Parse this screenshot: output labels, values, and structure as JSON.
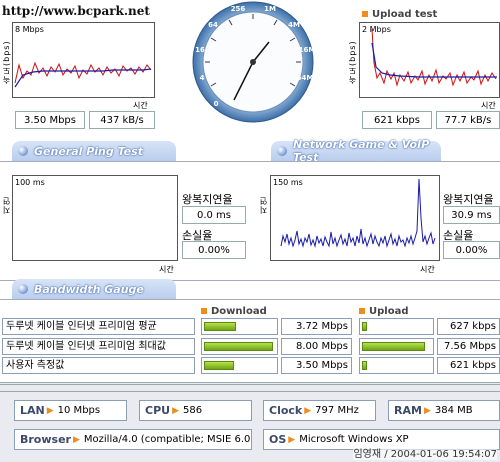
{
  "watermark": "http://www.bcpark.net",
  "download": {
    "axis_label": "속도(bps)",
    "scale": "8 Mbps",
    "time_label": "시간",
    "speed_bps": "3.50 Mbps",
    "speed_bytes": "437 kB/s"
  },
  "upload": {
    "title": "Upload test",
    "axis_label": "속도(bps)",
    "scale": "2 Mbps",
    "time_label": "시간",
    "speed_bps": "621 kbps",
    "speed_bytes": "77.7 kB/s"
  },
  "gauge": {
    "ticks": [
      "0",
      "4",
      "16",
      "64",
      "256",
      "1M",
      "4M",
      "16M",
      "64M"
    ]
  },
  "tabs": {
    "ping": "General Ping Test",
    "game": "Network Game & VoIP Test",
    "bandwidth": "Bandwidth Gauge"
  },
  "ping_general": {
    "axis_label": "지연(ms)",
    "scale": "100 ms",
    "time_label": "시간",
    "rtt_label": "왕복지연율",
    "rtt_value": "0.0 ms",
    "loss_label": "손실율",
    "loss_value": "0.00%"
  },
  "ping_game": {
    "axis_label": "지연(ms)",
    "scale": "150 ms",
    "time_label": "시간",
    "rtt_label": "왕복지연율",
    "rtt_value": "30.9 ms",
    "loss_label": "손실율",
    "loss_value": "0.00%"
  },
  "bandwidth": {
    "download_header": "Download",
    "upload_header": "Upload",
    "rows": [
      {
        "label": "두루넷 케이블 인터넷 프리미엄 평균",
        "down": "3.72 Mbps",
        "down_frac": 0.46,
        "up": "627 kbps",
        "up_frac": 0.08
      },
      {
        "label": "두루넷 케이블 인터넷 프리미엄 최대값",
        "down": "8.00 Mbps",
        "down_frac": 1.0,
        "up": "7.56 Mbps",
        "up_frac": 0.94
      },
      {
        "label": "사용자 측정값",
        "down": "3.50 Mbps",
        "down_frac": 0.44,
        "up": "621 kbps",
        "up_frac": 0.08
      }
    ]
  },
  "sysinfo": {
    "lan_key": "LAN",
    "lan_val": "10 Mbps",
    "cpu_key": "CPU",
    "cpu_val": "586",
    "clock_key": "Clock",
    "clock_val": "797 MHz",
    "ram_key": "RAM",
    "ram_val": "384 MB",
    "browser_key": "Browser",
    "browser_val": "Mozilla/4.0 (compatible; MSIE 6.0",
    "os_key": "OS",
    "os_val": "Microsoft Windows XP"
  },
  "footer_stamp": "임영재 / 2004-01-06 19:54:07",
  "colors": {
    "accent_orange": "#f08c1e",
    "chart_red": "#cc1111",
    "chart_blue": "#1a1aaa",
    "frame_blue": "#8c9db5"
  }
}
